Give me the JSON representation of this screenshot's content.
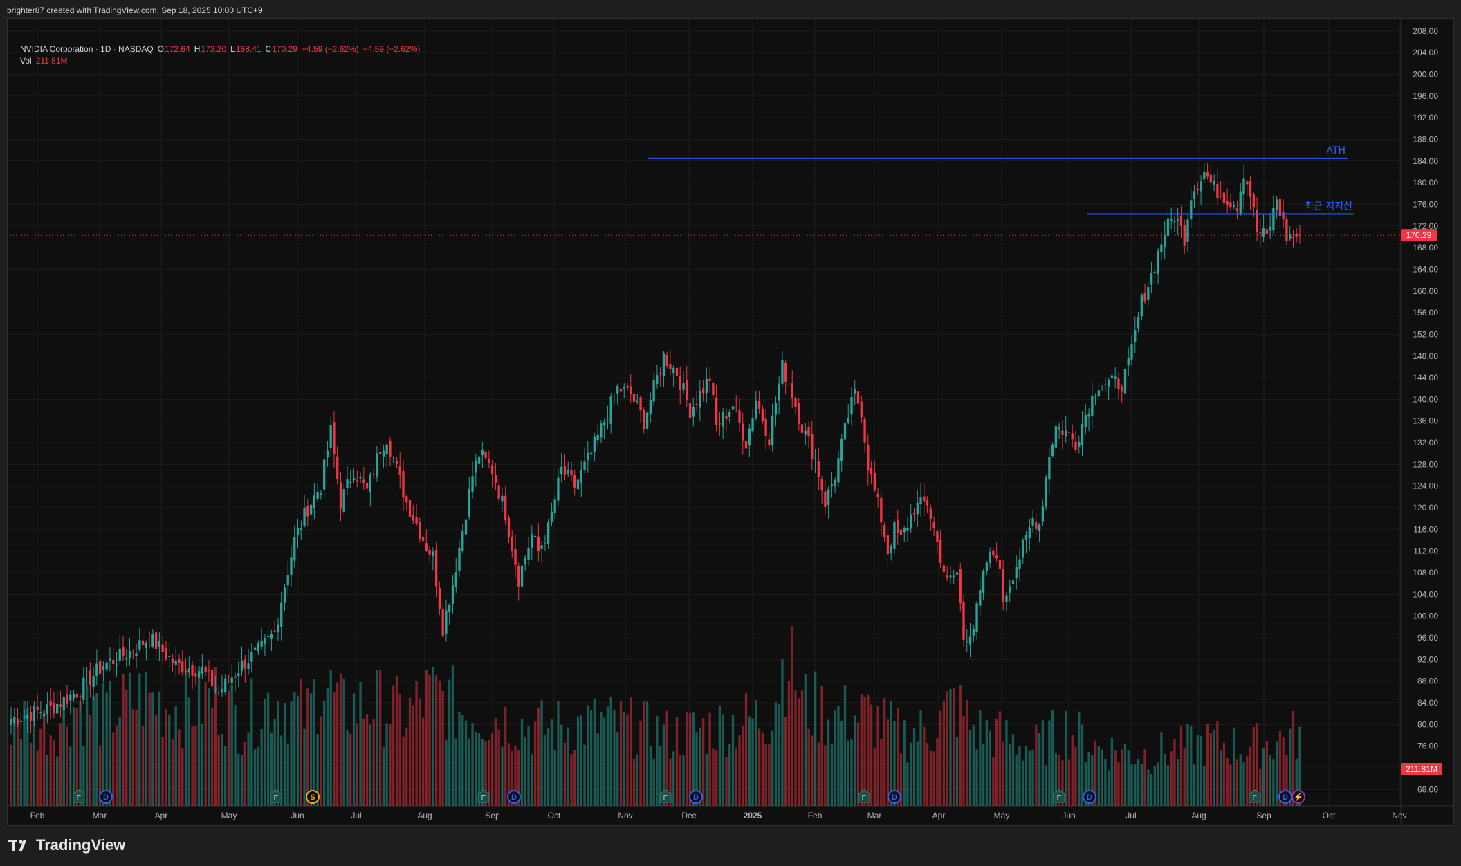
{
  "header": {
    "credit": "brighter87 created with TradingView.com, Sep 18, 2025 10:00 UTC+9"
  },
  "legend": {
    "symbol": "NVIDIA Corporation · 1D · NASDAQ",
    "o_label": "O",
    "o": "172.64",
    "h_label": "H",
    "h": "173.20",
    "l_label": "L",
    "l": "168.41",
    "c_label": "C",
    "c": "170.29",
    "change": "−4.59 (−2.62%)",
    "change2": "−4.59 (−2.62%)",
    "vol_label": "Vol",
    "vol": "211.81M"
  },
  "footer": {
    "brand": "TradingView"
  },
  "colors": {
    "up": "#26a69a",
    "down": "#f23645",
    "annotation": "#2962ff",
    "background": "#0f0f0f"
  },
  "chart_data": {
    "type": "candlestick",
    "symbol": "NVDA",
    "interval": "1D",
    "y_axis": {
      "min": 66,
      "max": 209,
      "ticks": [
        "208.00",
        "204.00",
        "200.00",
        "196.00",
        "192.00",
        "188.00",
        "184.00",
        "180.00",
        "176.00",
        "172.00",
        "168.00",
        "164.00",
        "160.00",
        "156.00",
        "152.00",
        "148.00",
        "144.00",
        "140.00",
        "136.00",
        "132.00",
        "128.00",
        "124.00",
        "120.00",
        "116.00",
        "112.00",
        "108.00",
        "104.00",
        "100.00",
        "96.00",
        "92.00",
        "88.00",
        "84.00",
        "80.00",
        "76.00",
        "72.00",
        "68.00"
      ]
    },
    "x_axis": {
      "labels": [
        "Feb",
        "Mar",
        "Apr",
        "May",
        "Jun",
        "Jul",
        "Aug",
        "Sep",
        "Oct",
        "Nov",
        "Dec",
        "2025",
        "Feb",
        "Mar",
        "Apr",
        "May",
        "Jun",
        "Jul",
        "Aug",
        "Sep",
        "Oct",
        "Nov"
      ]
    },
    "last_price": 170.29,
    "last_price_label": "170.29",
    "last_volume_label": "211.81M",
    "anchors": [
      [
        0,
        81
      ],
      [
        12,
        83
      ],
      [
        20,
        86
      ],
      [
        28,
        91
      ],
      [
        35,
        93
      ],
      [
        42,
        96
      ],
      [
        50,
        91
      ],
      [
        58,
        90
      ],
      [
        63,
        86
      ],
      [
        70,
        91
      ],
      [
        76,
        94
      ],
      [
        80,
        97
      ],
      [
        82,
        103
      ],
      [
        86,
        114
      ],
      [
        90,
        120
      ],
      [
        94,
        124
      ],
      [
        97,
        134
      ],
      [
        100,
        121
      ],
      [
        104,
        127
      ],
      [
        108,
        123
      ],
      [
        112,
        131
      ],
      [
        114,
        133
      ],
      [
        120,
        121
      ],
      [
        126,
        113
      ],
      [
        128,
        111
      ],
      [
        131,
        98
      ],
      [
        134,
        106
      ],
      [
        137,
        116
      ],
      [
        140,
        126
      ],
      [
        142,
        130
      ],
      [
        146,
        127
      ],
      [
        150,
        119
      ],
      [
        154,
        107
      ],
      [
        158,
        115
      ],
      [
        160,
        112
      ],
      [
        163,
        116
      ],
      [
        167,
        127
      ],
      [
        171,
        124
      ],
      [
        176,
        130
      ],
      [
        180,
        136
      ],
      [
        184,
        142
      ],
      [
        188,
        141
      ],
      [
        192,
        136
      ],
      [
        194,
        140
      ],
      [
        198,
        148
      ],
      [
        202,
        145
      ],
      [
        206,
        138
      ],
      [
        208,
        140
      ],
      [
        212,
        144
      ],
      [
        214,
        135
      ],
      [
        219,
        139
      ],
      [
        223,
        132
      ],
      [
        226,
        140
      ],
      [
        230,
        133
      ],
      [
        234,
        146
      ],
      [
        236,
        143
      ],
      [
        240,
        135
      ],
      [
        244,
        129
      ],
      [
        247,
        121
      ],
      [
        250,
        126
      ],
      [
        254,
        137
      ],
      [
        256,
        141
      ],
      [
        258,
        138
      ],
      [
        260,
        128
      ],
      [
        264,
        118
      ],
      [
        266,
        112
      ],
      [
        268,
        116
      ],
      [
        270,
        114
      ],
      [
        274,
        120
      ],
      [
        278,
        121
      ],
      [
        282,
        111
      ],
      [
        284,
        106
      ],
      [
        287,
        108
      ],
      [
        289,
        96
      ],
      [
        292,
        98
      ],
      [
        296,
        110
      ],
      [
        299,
        112
      ],
      [
        301,
        103
      ],
      [
        304,
        108
      ],
      [
        308,
        114
      ],
      [
        310,
        118
      ],
      [
        312,
        117
      ],
      [
        315,
        130
      ],
      [
        317,
        135
      ],
      [
        320,
        134
      ],
      [
        323,
        132
      ],
      [
        327,
        139
      ],
      [
        330,
        143
      ],
      [
        334,
        143
      ],
      [
        337,
        143
      ],
      [
        339,
        146
      ],
      [
        343,
        158
      ],
      [
        346,
        163
      ],
      [
        350,
        171
      ],
      [
        353,
        174
      ],
      [
        356,
        170
      ],
      [
        358,
        178
      ],
      [
        362,
        182
      ],
      [
        365,
        179
      ],
      [
        369,
        177
      ],
      [
        372,
        176
      ],
      [
        374,
        182
      ],
      [
        376,
        178
      ],
      [
        378,
        171
      ],
      [
        381,
        170
      ],
      [
        384,
        177
      ],
      [
        387,
        170
      ],
      [
        391,
        170.29
      ]
    ],
    "volume_anchors": [
      [
        0,
        140
      ],
      [
        12,
        120
      ],
      [
        20,
        160
      ],
      [
        28,
        140
      ],
      [
        40,
        170
      ],
      [
        52,
        150
      ],
      [
        62,
        170
      ],
      [
        70,
        130
      ],
      [
        80,
        170
      ],
      [
        90,
        140
      ],
      [
        94,
        200
      ],
      [
        100,
        150
      ],
      [
        110,
        160
      ],
      [
        120,
        140
      ],
      [
        126,
        170
      ],
      [
        130,
        170
      ],
      [
        136,
        150
      ],
      [
        146,
        140
      ],
      [
        160,
        120
      ],
      [
        180,
        130
      ],
      [
        200,
        110
      ],
      [
        210,
        120
      ],
      [
        230,
        140
      ],
      [
        236,
        250
      ],
      [
        240,
        160
      ],
      [
        250,
        140
      ],
      [
        260,
        140
      ],
      [
        270,
        110
      ],
      [
        280,
        120
      ],
      [
        286,
        160
      ],
      [
        292,
        120
      ],
      [
        300,
        110
      ],
      [
        310,
        90
      ],
      [
        320,
        120
      ],
      [
        330,
        90
      ],
      [
        345,
        80
      ],
      [
        355,
        90
      ],
      [
        365,
        100
      ],
      [
        375,
        90
      ],
      [
        391,
        112
      ]
    ],
    "overlays": [
      {
        "type": "horizontal_line",
        "price": 184.5,
        "x_start": "2024-11",
        "x_end": "2025-09",
        "label": "ATH"
      },
      {
        "type": "horizontal_line",
        "price": 174.2,
        "x_start": "2025-06",
        "x_end": "2025-09",
        "label": "최근 지지선"
      }
    ],
    "event_markers": [
      {
        "label": "E",
        "type": "earnings"
      },
      {
        "label": "D",
        "type": "dividend"
      },
      {
        "label": "E",
        "type": "earnings"
      },
      {
        "label": "S",
        "type": "split"
      },
      {
        "label": "E",
        "type": "earnings"
      },
      {
        "label": "D",
        "type": "dividend"
      },
      {
        "label": "E",
        "type": "earnings"
      },
      {
        "label": "D",
        "type": "dividend"
      },
      {
        "label": "E",
        "type": "earnings"
      },
      {
        "label": "D",
        "type": "dividend"
      },
      {
        "label": "E",
        "type": "earnings"
      },
      {
        "label": "D",
        "type": "dividend"
      },
      {
        "label": "E",
        "type": "earnings"
      },
      {
        "label": "D",
        "type": "dividend"
      },
      {
        "label": "⚡",
        "type": "event"
      }
    ],
    "grid": true
  }
}
